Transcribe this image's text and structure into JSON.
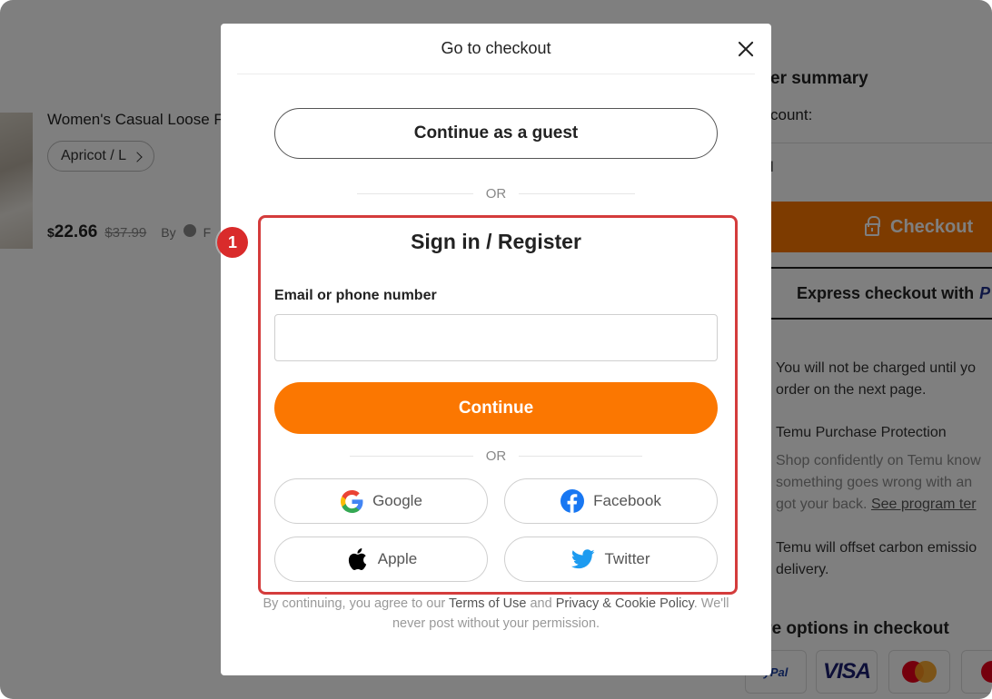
{
  "background": {
    "product": {
      "title": "Women's Casual Loose Fi",
      "variant": "Apricot / L",
      "price_currency": "$",
      "price": "22.66",
      "old_price": "$37.99",
      "by_label": "By",
      "seller_initial": "F"
    },
    "summary": {
      "title": "er summary",
      "count_label": "count:",
      "row_glimpse": "l",
      "checkout_label": "Checkout",
      "express_label": "Express checkout with",
      "express_brand": "P",
      "not_charged": [
        "You will not be charged until yo",
        "order on the next page."
      ],
      "protection_title": "Temu Purchase Protection",
      "protection_lines": [
        "Shop confidently on Temu know",
        "something goes wrong with an",
        "got your back."
      ],
      "protection_link": "See program ter",
      "carbon": [
        "Temu will offset carbon emissio",
        "delivery."
      ],
      "secure_title": "cure options in checkout",
      "pay_paypal": "yPal",
      "pay_visa": "VISA"
    }
  },
  "modal": {
    "title": "Go to checkout",
    "guest_button": "Continue as a guest",
    "or_text": "OR",
    "signin_title": "Sign in / Register",
    "email_label": "Email or phone number",
    "email_value": "",
    "continue_button": "Continue",
    "social": {
      "google": "Google",
      "facebook": "Facebook",
      "apple": "Apple",
      "twitter": "Twitter"
    },
    "terms": {
      "prefix": "By continuing, you agree to our",
      "terms_link": "Terms of Use",
      "and": "and",
      "privacy_link": "Privacy & Cookie Policy",
      "suffix": ". We'll never post without your permission."
    }
  },
  "annotation": {
    "step_number": "1",
    "highlight_color": "#d43c3c"
  },
  "colors": {
    "accent_orange": "#fb7701",
    "overlay": "rgba(0,0,0,0.5)",
    "facebook_blue": "#1877f2",
    "twitter_blue": "#1d9bf0"
  }
}
